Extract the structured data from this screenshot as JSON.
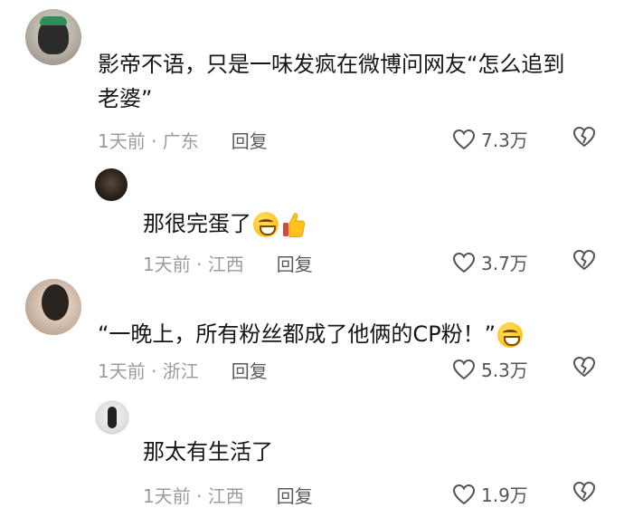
{
  "comments": [
    {
      "text": "影帝不语，只是一味发疯在微博问网友“怎么追到老婆”",
      "time_location": "1天前 · 广东",
      "reply_label": "回复",
      "likes": "7.3万"
    },
    {
      "text": "那很完蛋了",
      "time_location": "1天前 · 江西",
      "reply_label": "回复",
      "likes": "3.7万"
    },
    {
      "text": "“一晚上，所有粉丝都成了他俩的CP粉！”",
      "time_location": "1天前 · 浙江",
      "reply_label": "回复",
      "likes": "5.3万"
    },
    {
      "text": "那太有生活了",
      "time_location": "1天前 · 江西",
      "reply_label": "回复",
      "likes": "1.9万"
    }
  ],
  "colors": {
    "meta_text": "#9c9c9c",
    "reply_text": "#5b5b5b",
    "icon_stroke": "#555555"
  },
  "icons": {
    "like": "heart-outline-icon",
    "dislike": "broken-heart-icon",
    "emoji_smile": "grinning-emoji-icon",
    "emoji_thumb": "thumbs-up-emoji-icon"
  }
}
